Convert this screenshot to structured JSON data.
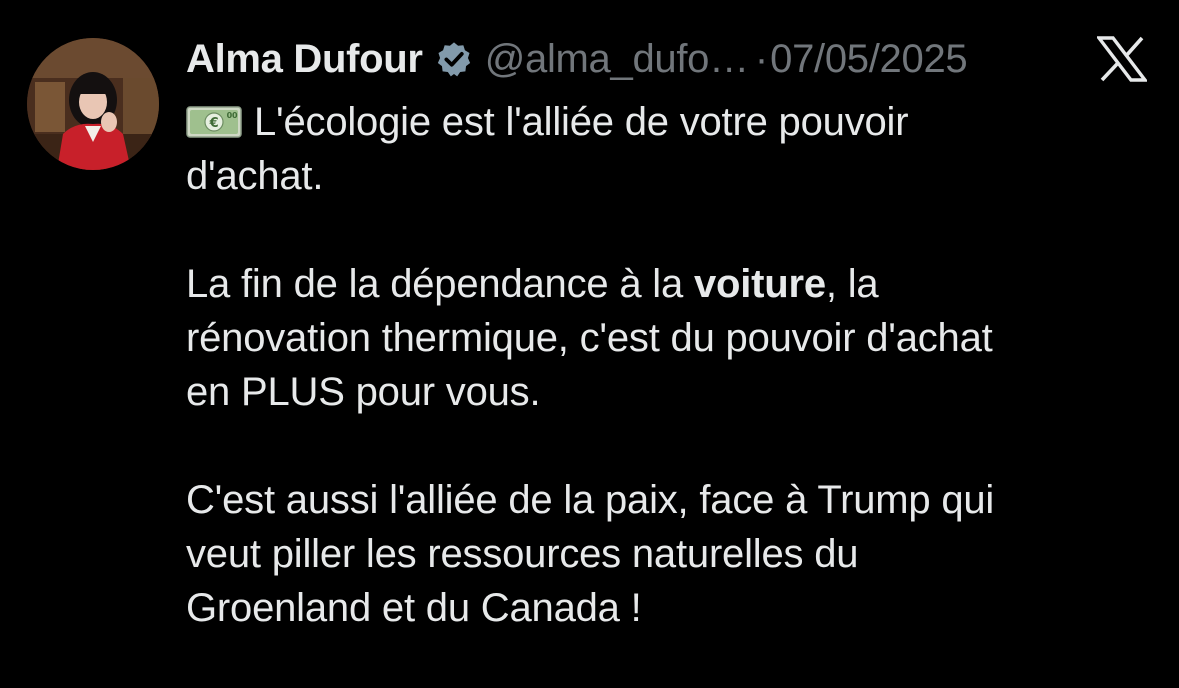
{
  "tweet": {
    "author_name": "Alma Dufour",
    "handle": "@alma_dufo…",
    "separator": "·",
    "date": "07/05/2025",
    "emoji_icon": "euro-banknote-icon",
    "lines": {
      "l1_text": "L'écologie est l'alliée de votre pouvoir",
      "l2": "d'achat.",
      "l4_pre": "La fin de la dépendance à la ",
      "l4_bold": "voiture",
      "l4_post": ", la",
      "l5": "rénovation thermique, c'est du pouvoir d'achat",
      "l6": "en PLUS pour vous.",
      "l8": "C'est aussi l'alliée de la paix, face à Trump qui",
      "l9": "veut piller les ressources naturelles du",
      "l10": "Groenland et du Canada !"
    }
  },
  "colors": {
    "background": "#000000",
    "text_primary": "#e7e9ea",
    "text_secondary": "#71767b",
    "verified_badge": "#829aab"
  }
}
